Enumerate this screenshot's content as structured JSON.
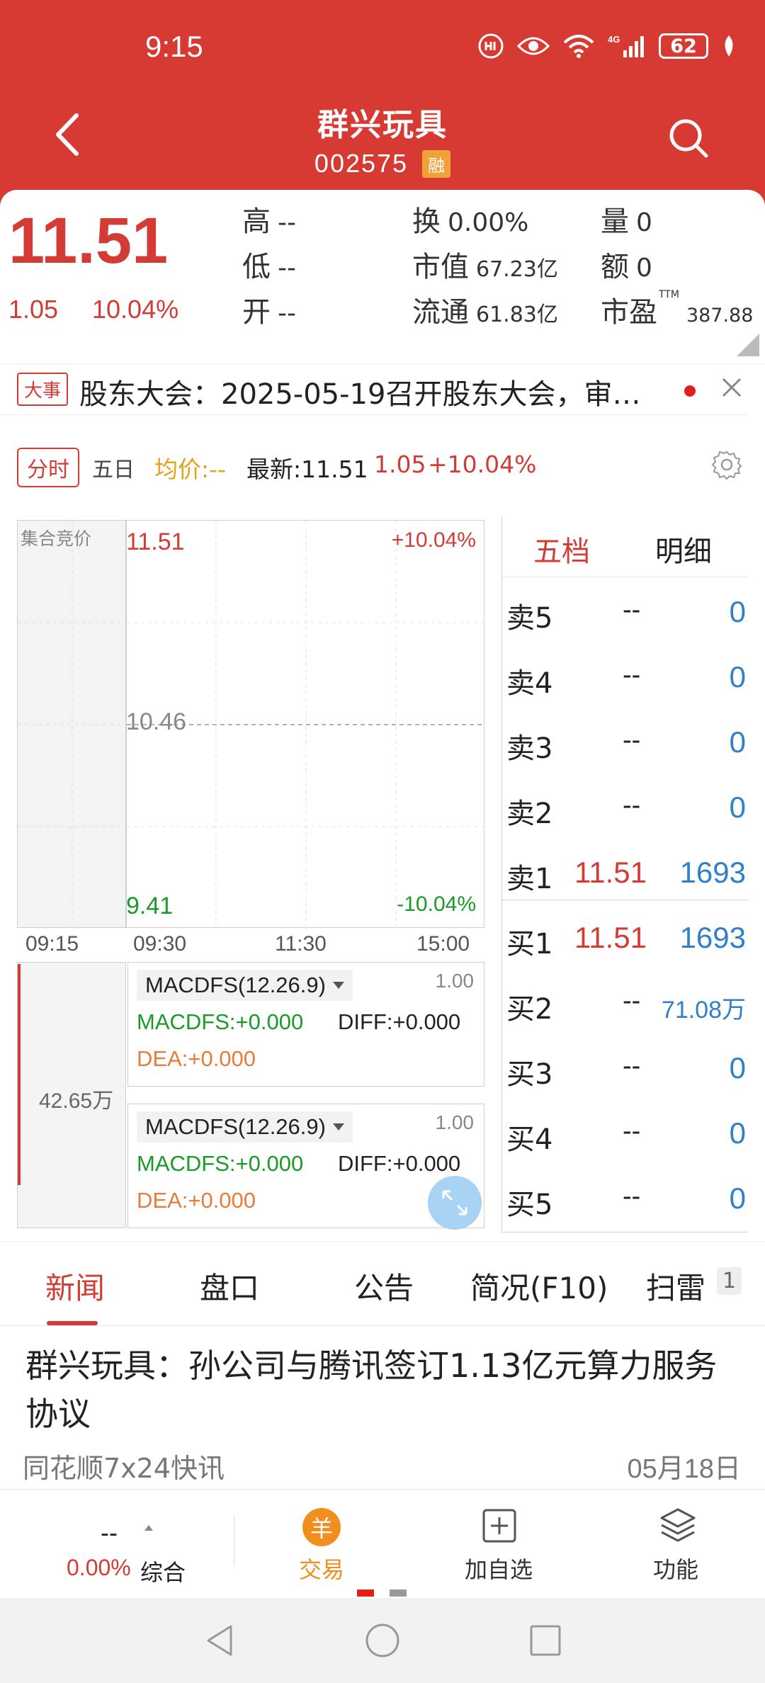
{
  "status_bar": {
    "time": "9:15",
    "battery": "62"
  },
  "header": {
    "stock_name": "群兴玩具",
    "stock_code": "002575",
    "badge": "融"
  },
  "quote": {
    "price": "11.51",
    "change": "1.05",
    "change_pct": "10.04%",
    "high_label": "高",
    "high_value": "--",
    "low_label": "低",
    "low_value": "--",
    "open_label": "开",
    "open_value": "--",
    "turnover_label": "换",
    "turnover_value": "0.00%",
    "mktcap_label": "市值",
    "mktcap_value": "67.23亿",
    "float_label": "流通",
    "float_value": "61.83亿",
    "volume_label": "量",
    "volume_value": "0",
    "amount_label": "额",
    "amount_value": "0",
    "pe_label": "市盈",
    "pe_sup": "TTM",
    "pe_value": "387.88"
  },
  "notice": {
    "badge": "大事",
    "text": "股东大会：2025-05-19召开股东大会，审…"
  },
  "chart_tabs": {
    "active": "分时",
    "five_day": "五日",
    "avg": "均价:--",
    "latest": "最新:11.51",
    "latest_change": "1.05",
    "latest_pct": "+10.04%"
  },
  "chart": {
    "auction_label": "集合竞价",
    "high": "11.51",
    "high_pct": "+10.04%",
    "mid": "10.46",
    "low": "9.41",
    "low_pct": "-10.04%",
    "times": [
      "09:15",
      "09:30",
      "11:30",
      "15:00"
    ],
    "volume_label": "42.65万"
  },
  "macd": [
    {
      "name": "MACDFS(12.26.9)",
      "scale": "1.00",
      "macdfs": "MACDFS:+0.000",
      "diff": "DIFF:+0.000",
      "dea": "DEA:+0.000"
    },
    {
      "name": "MACDFS(12.26.9)",
      "scale": "1.00",
      "macdfs": "MACDFS:+0.000",
      "diff": "DIFF:+0.000",
      "dea": "DEA:+0.000"
    }
  ],
  "orderbook": {
    "tab_active": "五档",
    "tab_other": "明细",
    "sell": [
      {
        "label": "卖5",
        "price": "--",
        "vol": "0"
      },
      {
        "label": "卖4",
        "price": "--",
        "vol": "0"
      },
      {
        "label": "卖3",
        "price": "--",
        "vol": "0"
      },
      {
        "label": "卖2",
        "price": "--",
        "vol": "0"
      },
      {
        "label": "卖1",
        "price": "11.51",
        "vol": "1693"
      }
    ],
    "buy": [
      {
        "label": "买1",
        "price": "11.51",
        "vol": "1693"
      },
      {
        "label": "买2",
        "price": "--",
        "vol": "71.08万"
      },
      {
        "label": "买3",
        "price": "--",
        "vol": "0"
      },
      {
        "label": "买4",
        "price": "--",
        "vol": "0"
      },
      {
        "label": "买5",
        "price": "--",
        "vol": "0"
      }
    ]
  },
  "news_tabs": [
    "新闻",
    "盘口",
    "公告",
    "简况(F10)",
    "扫雷"
  ],
  "news_badge": "1",
  "news": {
    "title": "群兴玩具：孙公司与腾讯签订1.13亿元算力服务协议",
    "source": "同花顺7x24快讯",
    "date": "05月18日"
  },
  "bottom_bar": {
    "index_value": "--",
    "index_pct": "0.00%",
    "index_name": "综合",
    "trade_icon": "羊",
    "trade": "交易",
    "add_watch": "加自选",
    "functions": "功能"
  }
}
